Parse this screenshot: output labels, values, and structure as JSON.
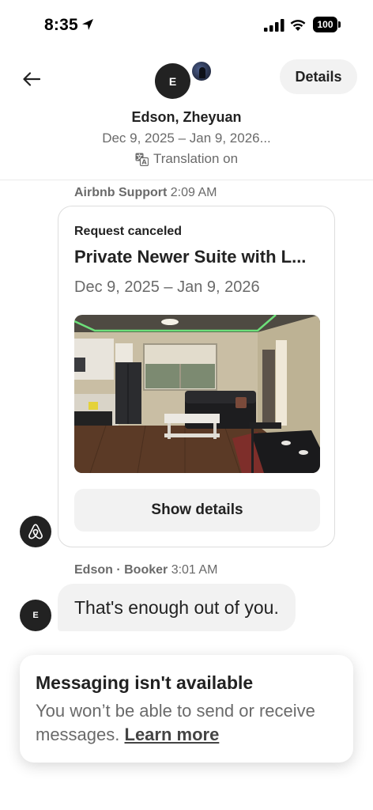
{
  "status_bar": {
    "time": "8:35",
    "battery": "100"
  },
  "header": {
    "avatar_initial": "E",
    "details_label": "Details",
    "name": "Edson, Zheyuan",
    "dates": "Dec 9, 2025 – Jan 9, 2026...",
    "translation": "Translation on"
  },
  "messages": [
    {
      "sender": "Airbnb Support",
      "time": "2:09 AM",
      "card": {
        "status": "Request canceled",
        "title": "Private Newer Suite with L...",
        "dates": "Dec 9, 2025 – Jan 9, 2026",
        "button_label": "Show details"
      }
    },
    {
      "sender": "Edson · Booker",
      "time": "3:01 AM",
      "avatar_initial": "E",
      "text": "That's enough out of you."
    }
  ],
  "notice": {
    "title": "Messaging isn't available",
    "body": "You won’t be able to send or receive messages. ",
    "link": "Learn more"
  },
  "icons": {
    "location": "location-arrow-icon",
    "signal": "cellular-signal-icon",
    "wifi": "wifi-icon",
    "back": "back-arrow-icon",
    "translate": "translate-icon",
    "airbnb": "airbnb-logo-icon"
  },
  "colors": {
    "text_primary": "#222222",
    "text_secondary": "#6a6a6a",
    "chip_background": "#f2f2f2"
  }
}
